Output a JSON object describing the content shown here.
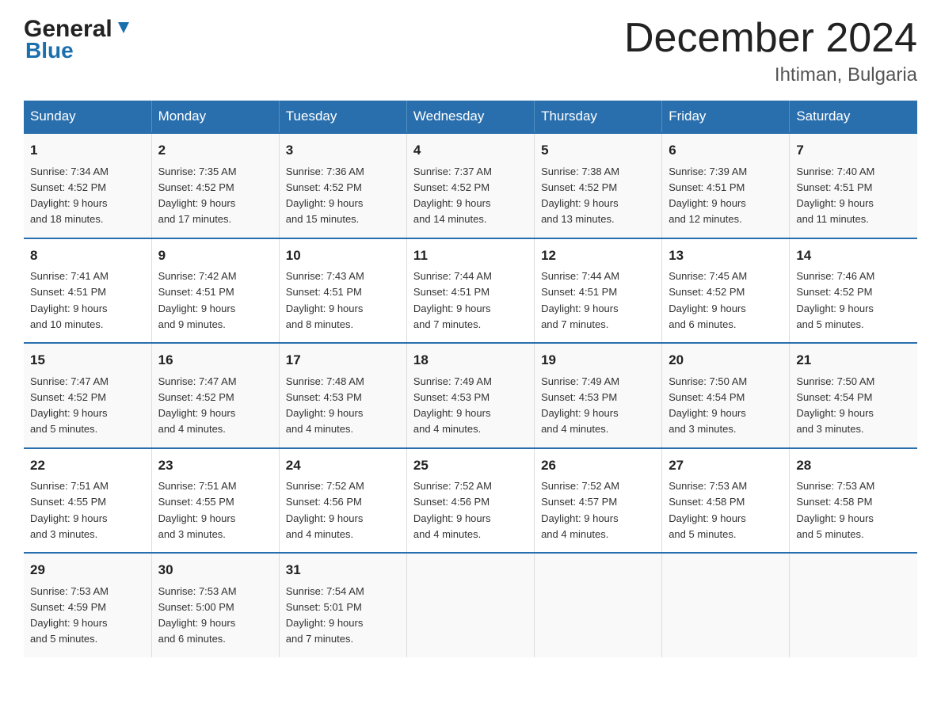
{
  "logo": {
    "line1": "General",
    "line2": "Blue"
  },
  "title": "December 2024",
  "subtitle": "Ihtiman, Bulgaria",
  "days_header": [
    "Sunday",
    "Monday",
    "Tuesday",
    "Wednesday",
    "Thursday",
    "Friday",
    "Saturday"
  ],
  "weeks": [
    [
      {
        "num": "1",
        "sunrise": "7:34 AM",
        "sunset": "4:52 PM",
        "daylight": "9 hours and 18 minutes."
      },
      {
        "num": "2",
        "sunrise": "7:35 AM",
        "sunset": "4:52 PM",
        "daylight": "9 hours and 17 minutes."
      },
      {
        "num": "3",
        "sunrise": "7:36 AM",
        "sunset": "4:52 PM",
        "daylight": "9 hours and 15 minutes."
      },
      {
        "num": "4",
        "sunrise": "7:37 AM",
        "sunset": "4:52 PM",
        "daylight": "9 hours and 14 minutes."
      },
      {
        "num": "5",
        "sunrise": "7:38 AM",
        "sunset": "4:52 PM",
        "daylight": "9 hours and 13 minutes."
      },
      {
        "num": "6",
        "sunrise": "7:39 AM",
        "sunset": "4:51 PM",
        "daylight": "9 hours and 12 minutes."
      },
      {
        "num": "7",
        "sunrise": "7:40 AM",
        "sunset": "4:51 PM",
        "daylight": "9 hours and 11 minutes."
      }
    ],
    [
      {
        "num": "8",
        "sunrise": "7:41 AM",
        "sunset": "4:51 PM",
        "daylight": "9 hours and 10 minutes."
      },
      {
        "num": "9",
        "sunrise": "7:42 AM",
        "sunset": "4:51 PM",
        "daylight": "9 hours and 9 minutes."
      },
      {
        "num": "10",
        "sunrise": "7:43 AM",
        "sunset": "4:51 PM",
        "daylight": "9 hours and 8 minutes."
      },
      {
        "num": "11",
        "sunrise": "7:44 AM",
        "sunset": "4:51 PM",
        "daylight": "9 hours and 7 minutes."
      },
      {
        "num": "12",
        "sunrise": "7:44 AM",
        "sunset": "4:51 PM",
        "daylight": "9 hours and 7 minutes."
      },
      {
        "num": "13",
        "sunrise": "7:45 AM",
        "sunset": "4:52 PM",
        "daylight": "9 hours and 6 minutes."
      },
      {
        "num": "14",
        "sunrise": "7:46 AM",
        "sunset": "4:52 PM",
        "daylight": "9 hours and 5 minutes."
      }
    ],
    [
      {
        "num": "15",
        "sunrise": "7:47 AM",
        "sunset": "4:52 PM",
        "daylight": "9 hours and 5 minutes."
      },
      {
        "num": "16",
        "sunrise": "7:47 AM",
        "sunset": "4:52 PM",
        "daylight": "9 hours and 4 minutes."
      },
      {
        "num": "17",
        "sunrise": "7:48 AM",
        "sunset": "4:53 PM",
        "daylight": "9 hours and 4 minutes."
      },
      {
        "num": "18",
        "sunrise": "7:49 AM",
        "sunset": "4:53 PM",
        "daylight": "9 hours and 4 minutes."
      },
      {
        "num": "19",
        "sunrise": "7:49 AM",
        "sunset": "4:53 PM",
        "daylight": "9 hours and 4 minutes."
      },
      {
        "num": "20",
        "sunrise": "7:50 AM",
        "sunset": "4:54 PM",
        "daylight": "9 hours and 3 minutes."
      },
      {
        "num": "21",
        "sunrise": "7:50 AM",
        "sunset": "4:54 PM",
        "daylight": "9 hours and 3 minutes."
      }
    ],
    [
      {
        "num": "22",
        "sunrise": "7:51 AM",
        "sunset": "4:55 PM",
        "daylight": "9 hours and 3 minutes."
      },
      {
        "num": "23",
        "sunrise": "7:51 AM",
        "sunset": "4:55 PM",
        "daylight": "9 hours and 3 minutes."
      },
      {
        "num": "24",
        "sunrise": "7:52 AM",
        "sunset": "4:56 PM",
        "daylight": "9 hours and 4 minutes."
      },
      {
        "num": "25",
        "sunrise": "7:52 AM",
        "sunset": "4:56 PM",
        "daylight": "9 hours and 4 minutes."
      },
      {
        "num": "26",
        "sunrise": "7:52 AM",
        "sunset": "4:57 PM",
        "daylight": "9 hours and 4 minutes."
      },
      {
        "num": "27",
        "sunrise": "7:53 AM",
        "sunset": "4:58 PM",
        "daylight": "9 hours and 5 minutes."
      },
      {
        "num": "28",
        "sunrise": "7:53 AM",
        "sunset": "4:58 PM",
        "daylight": "9 hours and 5 minutes."
      }
    ],
    [
      {
        "num": "29",
        "sunrise": "7:53 AM",
        "sunset": "4:59 PM",
        "daylight": "9 hours and 5 minutes."
      },
      {
        "num": "30",
        "sunrise": "7:53 AM",
        "sunset": "5:00 PM",
        "daylight": "9 hours and 6 minutes."
      },
      {
        "num": "31",
        "sunrise": "7:54 AM",
        "sunset": "5:01 PM",
        "daylight": "9 hours and 7 minutes."
      },
      null,
      null,
      null,
      null
    ]
  ],
  "labels": {
    "sunrise": "Sunrise:",
    "sunset": "Sunset:",
    "daylight": "Daylight:"
  }
}
